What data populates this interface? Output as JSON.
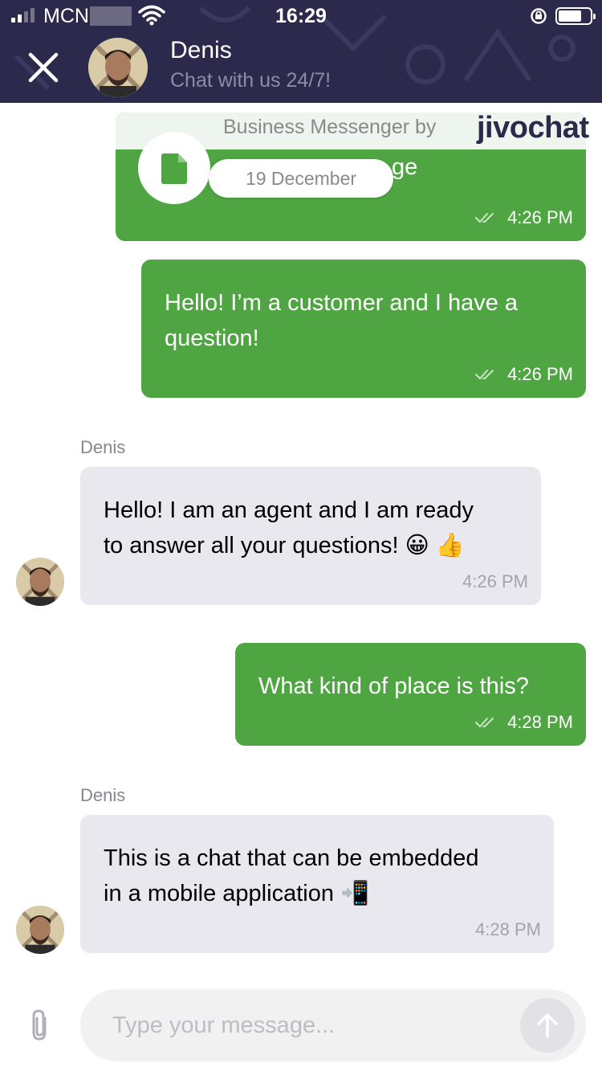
{
  "status_bar": {
    "carrier": "MCN",
    "time": "16:29"
  },
  "header": {
    "agent_name": "Denis",
    "subtitle": "Chat with us 24/7!",
    "background_color": "#2b2a4c"
  },
  "branding": {
    "text": "Business Messenger by",
    "logo": "jivochat"
  },
  "date_separator": "19 December",
  "partial_first_message_text": "ge",
  "messages": [
    {
      "direction": "out",
      "text": "",
      "time": "4:26 PM",
      "status_icon": "double-check-icon"
    },
    {
      "direction": "out",
      "text_lines": [
        "Hello! I’m a customer and I have a",
        "question!"
      ],
      "time": "4:26 PM",
      "status_icon": "double-check-icon"
    },
    {
      "direction": "in",
      "sender": "Denis",
      "text_lines": [
        "Hello! I am an agent and I am ready",
        "to answer all your questions! 😀 👍"
      ],
      "time": "4:26 PM"
    },
    {
      "direction": "out",
      "text_lines": [
        "What kind of place is this?"
      ],
      "time": "4:28 PM",
      "status_icon": "double-check-icon"
    },
    {
      "direction": "in",
      "sender": "Denis",
      "text_lines": [
        "This is a chat that can be embedded",
        "in a mobile application 📲"
      ],
      "time": "4:28 PM"
    }
  ],
  "composer": {
    "placeholder": "Type your message..."
  },
  "colors": {
    "outgoing_bubble": "#4ea541",
    "incoming_bubble": "#e8e8ee",
    "accent": "#2b2a4c"
  }
}
